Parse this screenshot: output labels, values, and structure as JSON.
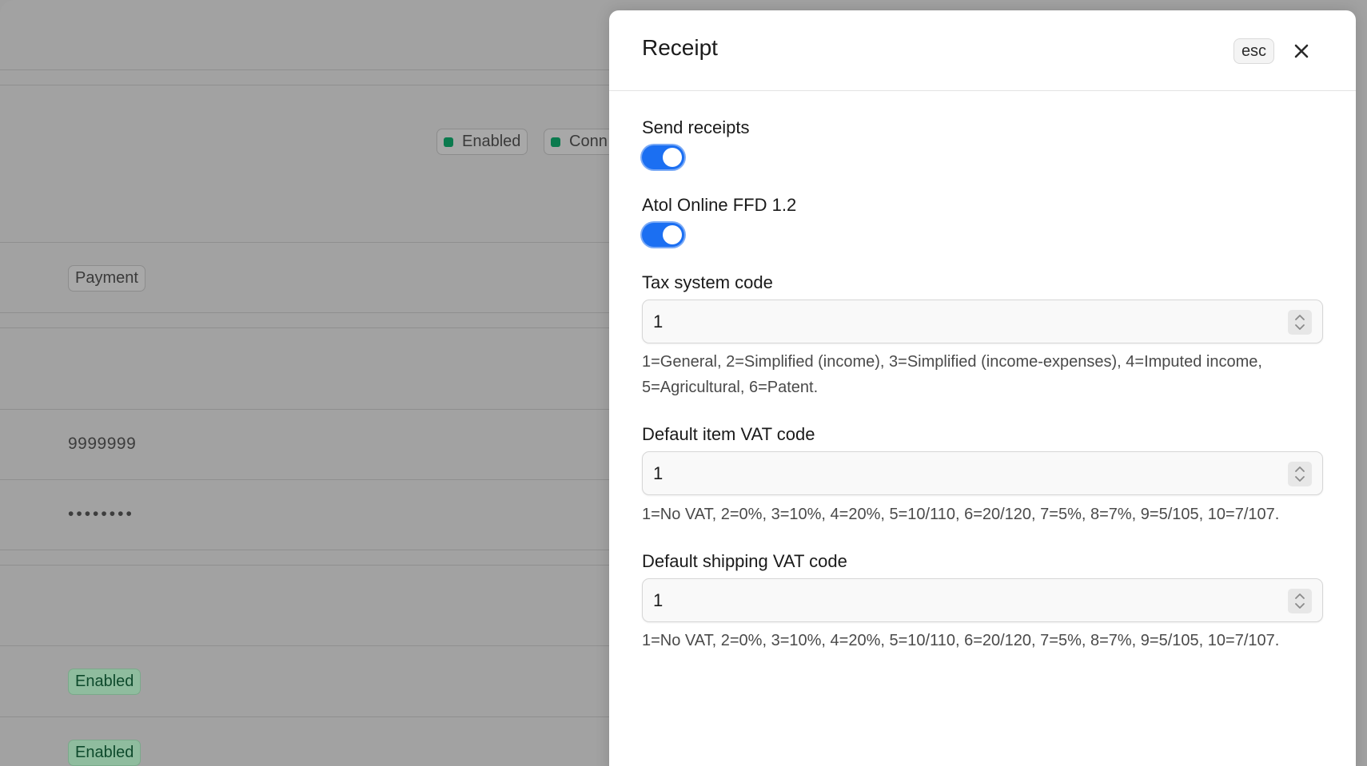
{
  "background": {
    "badges_top": [
      {
        "label": "Enabled"
      },
      {
        "label": "Conn"
      }
    ],
    "payment_badge": "Payment",
    "merchant_id": "9999999",
    "password_mask": "••••••••",
    "status_badges": [
      "Enabled",
      "Enabled"
    ]
  },
  "drawer": {
    "title": "Receipt",
    "esc_label": "esc",
    "close_icon": "close-icon",
    "send_receipts": {
      "label": "Send receipts",
      "enabled": true
    },
    "atol_ffd": {
      "label": "Atol Online FFD 1.2",
      "enabled": true
    },
    "tax_system_code": {
      "label": "Tax system code",
      "value": "1",
      "help": "1=General, 2=Simplified (income), 3=Simplified (income-expenses), 4=Imputed income, 5=Agricultural, 6=Patent."
    },
    "default_item_vat": {
      "label": "Default item VAT code",
      "value": "1",
      "help": "1=No VAT, 2=0%, 3=10%, 4=20%, 5=10/110, 6=20/120, 7=5%, 8=7%, 9=5/105, 10=7/107."
    },
    "default_shipping_vat": {
      "label": "Default shipping VAT code",
      "value": "1",
      "help": "1=No VAT, 2=0%, 3=10%, 4=20%, 5=10/110, 6=20/120, 7=5%, 8=7%, 9=5/105, 10=7/107."
    }
  },
  "colors": {
    "accent": "#1b6ff2",
    "overlay": "#a2a2a2",
    "status_green": "#0b7a4e"
  }
}
